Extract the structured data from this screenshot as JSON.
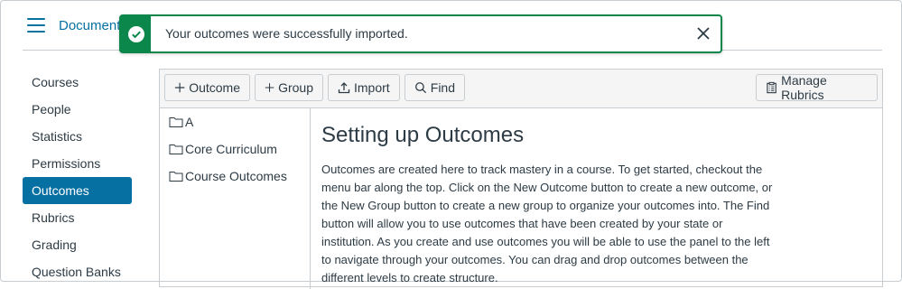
{
  "header": {
    "breadcrumb": "Document"
  },
  "toast": {
    "message": "Your outcomes were successfully imported.",
    "accent_color": "#0b874b"
  },
  "nav": {
    "items": [
      {
        "label": "Courses"
      },
      {
        "label": "People"
      },
      {
        "label": "Statistics"
      },
      {
        "label": "Permissions"
      },
      {
        "label": "Outcomes",
        "active": true
      },
      {
        "label": "Rubrics"
      },
      {
        "label": "Grading"
      },
      {
        "label": "Question Banks"
      }
    ],
    "active_color": "#0770a3"
  },
  "toolbar": {
    "outcome_label": "Outcome",
    "group_label": "Group",
    "import_label": "Import",
    "find_label": "Find",
    "manage_rubrics_label": "Manage Rubrics"
  },
  "tree": {
    "items": [
      {
        "label": "A"
      },
      {
        "label": "Core Curriculum"
      },
      {
        "label": "Course Outcomes"
      }
    ]
  },
  "content": {
    "title": "Setting up Outcomes",
    "body": "Outcomes are created here to track mastery in a course. To get started, checkout the menu bar along the top. Click on the New Outcome button to create a new outcome, or the New Group button to create a new group to organize your outcomes into. The Find button will allow you to use outcomes that have been created by your state or institution. As you create and use outcomes you will be able to use the panel to the left to navigate through your outcomes. You can drag and drop outcomes between the different levels to create structure."
  }
}
